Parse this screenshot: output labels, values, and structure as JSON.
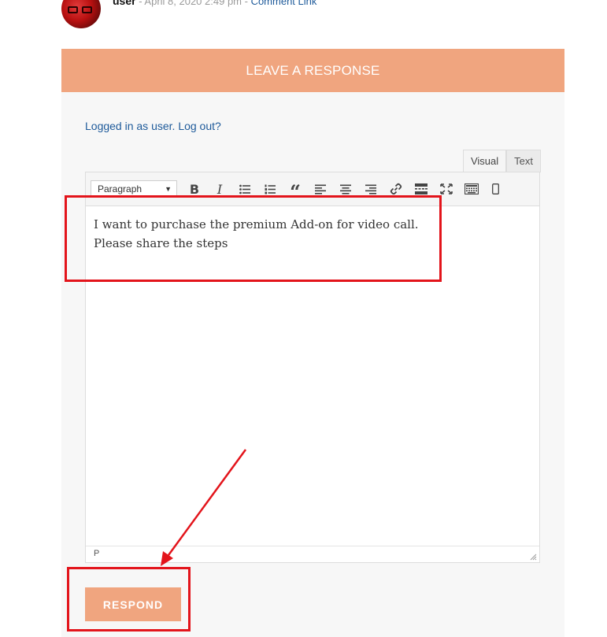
{
  "comment": {
    "author": "user",
    "separator1": " - ",
    "date": "April 8, 2020 2:49 pm",
    "separator2": " - ",
    "link": "Comment Link"
  },
  "panel": {
    "header": "LEAVE A RESPONSE",
    "logged_in_text": "Logged in as user.",
    "logout_link": "Log out?"
  },
  "editor": {
    "tabs": [
      {
        "label": "Visual",
        "active": true
      },
      {
        "label": "Text",
        "active": false
      }
    ],
    "format_select": "Paragraph",
    "toolbar_icons": [
      "bold-icon",
      "italic-icon",
      "bulleted-list-icon",
      "numbered-list-icon",
      "blockquote-icon",
      "align-left-icon",
      "align-center-icon",
      "align-right-icon",
      "link-icon",
      "read-more-icon",
      "fullscreen-icon",
      "toolbar-toggle-icon",
      "mobile-preview-icon"
    ],
    "content_lines": [
      "I want to purchase the premium Add-on for video call.",
      "Please share the steps"
    ],
    "status_path": "P"
  },
  "respond_label": "RESPOND",
  "colors": {
    "accent": "#f0a57f",
    "link": "#1e5a9a",
    "annotation": "#e3141b"
  }
}
